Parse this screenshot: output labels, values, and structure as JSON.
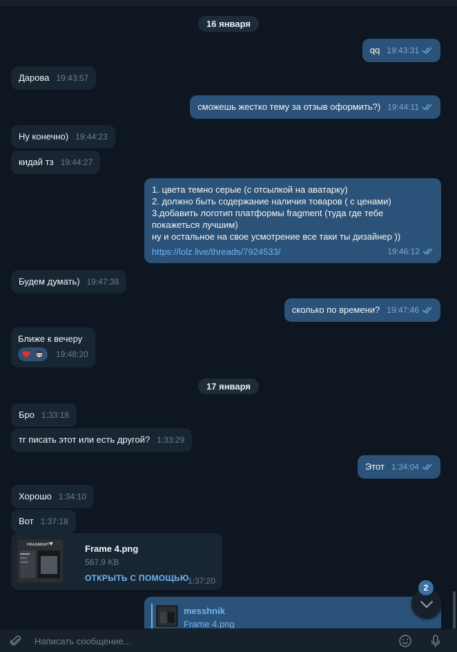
{
  "dates": [
    "16 января",
    "17 января"
  ],
  "messages": [
    {
      "dir": "out",
      "text": "qq",
      "time": "19:43:31"
    },
    {
      "dir": "in",
      "text": "Дарова",
      "time": "19:43:57"
    },
    {
      "dir": "out",
      "text": "сможешь жестко тему за отзыв оформить?)",
      "time": "19:44:11"
    },
    {
      "dir": "in",
      "text": "Ну конечно)",
      "time": "19:44:23"
    },
    {
      "dir": "in",
      "text": "кидай тз",
      "time": "19:44:27"
    },
    {
      "dir": "out",
      "lines": [
        "1. цвета темно серые (с отсылкой на аватарку)",
        "2. должно быть содержание наличия товаров ( с ценами)",
        "3.добавить логотип платформы fragment (туда где тебе",
        "покажеться лучшим)",
        "ну и остальное на свое усмотрение все таки ты дизайнер ))"
      ],
      "link": "https://lolz.live/threads/7924533/",
      "time": "19:46:12"
    },
    {
      "dir": "in",
      "text": "Будем думать)",
      "time": "19:47:38"
    },
    {
      "dir": "out",
      "text": "сколько по времени?",
      "time": "19:47:46"
    },
    {
      "dir": "in",
      "text": "Ближе к вечеру",
      "time": "19:48:20",
      "reactions": [
        "heart",
        "pirate"
      ]
    },
    {
      "dir": "in",
      "text": "Бро",
      "time": "1:33:18"
    },
    {
      "dir": "in",
      "text": "тг писать этот или есть другой?",
      "time": "1:33:29"
    },
    {
      "dir": "out",
      "text": "Этот",
      "time": "1:34:04"
    },
    {
      "dir": "in",
      "text": "Хорошо",
      "time": "1:34:10"
    },
    {
      "dir": "in",
      "text": "Вот",
      "time": "1:37:18"
    }
  ],
  "file": {
    "name": "Frame 4.png",
    "size": "567.9 KB",
    "action": "ОТКРЫТЬ С ПОМОЩЬЮ",
    "time": "1:37:20",
    "thumb_caption": "FRAGMENT"
  },
  "reply": {
    "author": "messhnik",
    "file": "Frame 4.png"
  },
  "scroll_down": {
    "unread": "2"
  },
  "composer": {
    "placeholder": "Написать сообщение..."
  },
  "colors": {
    "background": "#0e1621",
    "incoming": "#182533",
    "outgoing": "#2b5278",
    "accent": "#71b4f0",
    "ticks": "#6aaae8"
  }
}
